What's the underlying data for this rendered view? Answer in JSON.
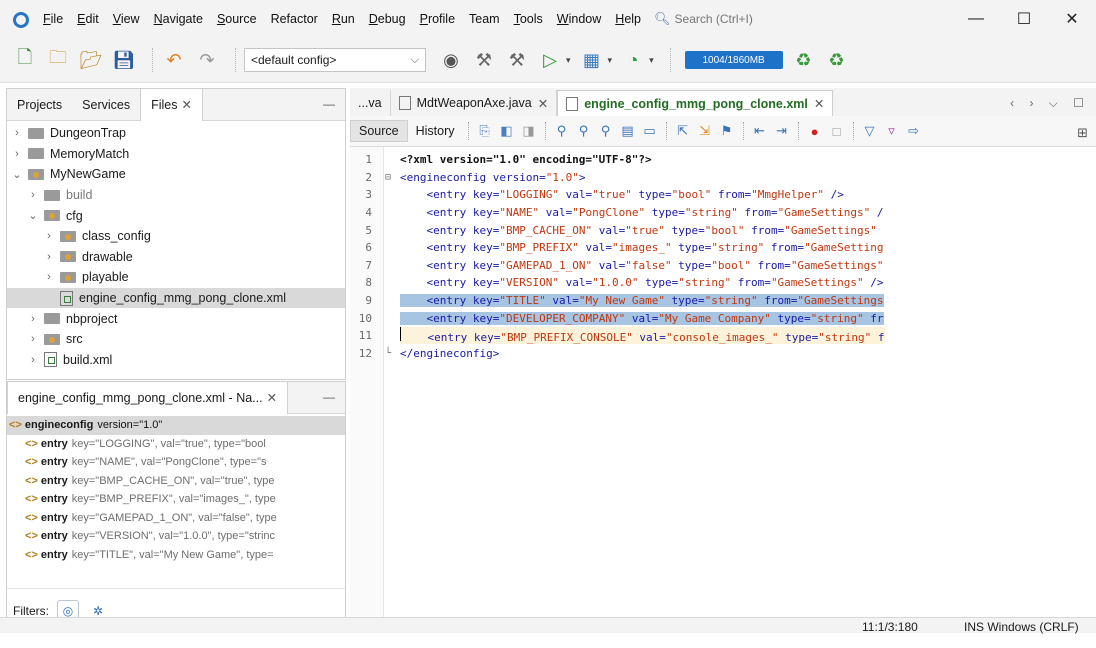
{
  "menu": {
    "items": [
      {
        "label": "File",
        "u": "F",
        "rest": "ile"
      },
      {
        "label": "Edit",
        "u": "E",
        "rest": "dit"
      },
      {
        "label": "View",
        "u": "V",
        "rest": "iew"
      },
      {
        "label": "Navigate",
        "u": "N",
        "rest": "avigate"
      },
      {
        "label": "Source",
        "u": "S",
        "rest": "ource"
      },
      {
        "label": "Refactor",
        "u": "",
        "rest": "Refactor"
      },
      {
        "label": "Run",
        "u": "R",
        "rest": "un"
      },
      {
        "label": "Debug",
        "u": "D",
        "rest": "ebug"
      },
      {
        "label": "Profile",
        "u": "P",
        "rest": "rofile"
      },
      {
        "label": "Team",
        "u": "",
        "rest": "Team"
      },
      {
        "label": "Tools",
        "u": "T",
        "rest": "ools"
      },
      {
        "label": "Window",
        "u": "W",
        "rest": "indow"
      },
      {
        "label": "Help",
        "u": "H",
        "rest": "elp"
      }
    ],
    "search_placeholder": "Search (Ctrl+I)"
  },
  "toolbar": {
    "config": "<default config>",
    "memory": "1004/1860MB"
  },
  "projects_panel": {
    "tabs": [
      "Projects",
      "Services",
      "Files"
    ],
    "tree": [
      {
        "label": "DungeonTrap",
        "indent": 0,
        "arrow": ">",
        "icon": "folder",
        "dim": false,
        "selected": false
      },
      {
        "label": "MemoryMatch",
        "indent": 0,
        "arrow": ">",
        "icon": "folder",
        "dim": false,
        "selected": false
      },
      {
        "label": "MyNewGame",
        "indent": 0,
        "arrow": "v",
        "icon": "pkg",
        "dim": false,
        "selected": false
      },
      {
        "label": "build",
        "indent": 1,
        "arrow": ">",
        "icon": "folder",
        "dim": true,
        "selected": false
      },
      {
        "label": "cfg",
        "indent": 1,
        "arrow": "v",
        "icon": "pkg",
        "dim": false,
        "selected": false
      },
      {
        "label": "class_config",
        "indent": 2,
        "arrow": ">",
        "icon": "pkg",
        "dim": false,
        "selected": false
      },
      {
        "label": "drawable",
        "indent": 2,
        "arrow": ">",
        "icon": "pkg",
        "dim": false,
        "selected": false
      },
      {
        "label": "playable",
        "indent": 2,
        "arrow": ">",
        "icon": "pkg",
        "dim": false,
        "selected": false
      },
      {
        "label": "engine_config_mmg_pong_clone.xml",
        "indent": 2,
        "arrow": "",
        "icon": "xml",
        "dim": false,
        "selected": true
      },
      {
        "label": "nbproject",
        "indent": 1,
        "arrow": ">",
        "icon": "folder",
        "dim": false,
        "selected": false
      },
      {
        "label": "src",
        "indent": 1,
        "arrow": ">",
        "icon": "pkg",
        "dim": false,
        "selected": false
      },
      {
        "label": "build.xml",
        "indent": 1,
        "arrow": ">",
        "icon": "xml",
        "dim": false,
        "selected": false
      }
    ]
  },
  "navigator": {
    "title": "engine_config_mmg_pong_clone.xml - Na...",
    "root": {
      "element": "engineconfig",
      "attrs": "version=\"1.0\""
    },
    "entries": [
      "key=\"LOGGING\", val=\"true\", type=\"bool",
      "key=\"NAME\", val=\"PongClone\", type=\"s",
      "key=\"BMP_CACHE_ON\", val=\"true\", type",
      "key=\"BMP_PREFIX\", val=\"images_\", type",
      "key=\"GAMEPAD_1_ON\", val=\"false\", type",
      "key=\"VERSION\", val=\"1.0.0\", type=\"strinc",
      "key=\"TITLE\", val=\"My New Game\", type="
    ],
    "entry_element": "entry",
    "filters_label": "Filters:"
  },
  "editor": {
    "tabs": [
      {
        "label": "...va",
        "active": false,
        "icon": false
      },
      {
        "label": "MdtWeaponAxe.java",
        "active": false,
        "icon": true
      },
      {
        "label": "engine_config_mmg_pong_clone.xml",
        "active": true,
        "icon": true
      }
    ],
    "modes": [
      "Source",
      "History"
    ],
    "lines": [
      {
        "n": "1",
        "fold": "",
        "state": "",
        "parts": [
          [
            "pi",
            "<?xml version=\"1.0\" encoding=\"UTF-8\"?>"
          ]
        ]
      },
      {
        "n": "2",
        "fold": "⊟",
        "state": "",
        "parts": [
          [
            "tag",
            "<engineconfig "
          ],
          [
            "attr",
            "version="
          ],
          [
            "str",
            "\"1.0\""
          ],
          [
            "tag",
            ">"
          ]
        ]
      },
      {
        "n": "3",
        "fold": "",
        "state": "",
        "parts": [
          [
            "plain",
            "    "
          ],
          [
            "tag",
            "<entry "
          ],
          [
            "attr",
            "key="
          ],
          [
            "str",
            "\"LOGGING\""
          ],
          [
            "attr",
            " val="
          ],
          [
            "str",
            "\"true\""
          ],
          [
            "attr",
            " type="
          ],
          [
            "str",
            "\"bool\""
          ],
          [
            "attr",
            " from="
          ],
          [
            "str",
            "\"MmgHelper\""
          ],
          [
            "tag",
            " />"
          ]
        ]
      },
      {
        "n": "4",
        "fold": "",
        "state": "",
        "parts": [
          [
            "plain",
            "    "
          ],
          [
            "tag",
            "<entry "
          ],
          [
            "attr",
            "key="
          ],
          [
            "str",
            "\"NAME\""
          ],
          [
            "attr",
            " val="
          ],
          [
            "str",
            "\"PongClone\""
          ],
          [
            "attr",
            " type="
          ],
          [
            "str",
            "\"string\""
          ],
          [
            "attr",
            " from="
          ],
          [
            "str",
            "\"GameSettings\""
          ],
          [
            "tag",
            " /"
          ]
        ]
      },
      {
        "n": "5",
        "fold": "",
        "state": "",
        "parts": [
          [
            "plain",
            "    "
          ],
          [
            "tag",
            "<entry "
          ],
          [
            "attr",
            "key="
          ],
          [
            "str",
            "\"BMP_CACHE_ON\""
          ],
          [
            "attr",
            " val="
          ],
          [
            "str",
            "\"true\""
          ],
          [
            "attr",
            " type="
          ],
          [
            "str",
            "\"bool\""
          ],
          [
            "attr",
            " from="
          ],
          [
            "str",
            "\"GameSettings\""
          ]
        ]
      },
      {
        "n": "6",
        "fold": "",
        "state": "",
        "parts": [
          [
            "plain",
            "    "
          ],
          [
            "tag",
            "<entry "
          ],
          [
            "attr",
            "key="
          ],
          [
            "str",
            "\"BMP_PREFIX\""
          ],
          [
            "attr",
            " val="
          ],
          [
            "str",
            "\"images_\""
          ],
          [
            "attr",
            " type="
          ],
          [
            "str",
            "\"string\""
          ],
          [
            "attr",
            " from="
          ],
          [
            "str",
            "\"GameSetting"
          ]
        ]
      },
      {
        "n": "7",
        "fold": "",
        "state": "",
        "parts": [
          [
            "plain",
            "    "
          ],
          [
            "tag",
            "<entry "
          ],
          [
            "attr",
            "key="
          ],
          [
            "str",
            "\"GAMEPAD_1_ON\""
          ],
          [
            "attr",
            " val="
          ],
          [
            "str",
            "\"false\""
          ],
          [
            "attr",
            " type="
          ],
          [
            "str",
            "\"bool\""
          ],
          [
            "attr",
            " from="
          ],
          [
            "str",
            "\"GameSettings\""
          ]
        ]
      },
      {
        "n": "8",
        "fold": "",
        "state": "",
        "parts": [
          [
            "plain",
            "    "
          ],
          [
            "tag",
            "<entry "
          ],
          [
            "attr",
            "key="
          ],
          [
            "str",
            "\"VERSION\""
          ],
          [
            "attr",
            " val="
          ],
          [
            "str",
            "\"1.0.0\""
          ],
          [
            "attr",
            " type="
          ],
          [
            "str",
            "\"string\""
          ],
          [
            "attr",
            " from="
          ],
          [
            "str",
            "\"GameSettings\""
          ],
          [
            "tag",
            " />"
          ]
        ]
      },
      {
        "n": "9",
        "fold": "",
        "state": "sel",
        "parts": [
          [
            "plain",
            "    "
          ],
          [
            "tag",
            "<entry "
          ],
          [
            "attr",
            "key="
          ],
          [
            "str",
            "\"TITLE\""
          ],
          [
            "attr",
            " val="
          ],
          [
            "str",
            "\"My New Game\""
          ],
          [
            "attr",
            " type="
          ],
          [
            "str",
            "\"string\""
          ],
          [
            "attr",
            " from="
          ],
          [
            "str",
            "\"GameSettings"
          ]
        ]
      },
      {
        "n": "10",
        "fold": "",
        "state": "sel",
        "parts": [
          [
            "plain",
            "    "
          ],
          [
            "tag",
            "<entry "
          ],
          [
            "attr",
            "key="
          ],
          [
            "str",
            "\"DEVELOPER_COMPANY\""
          ],
          [
            "attr",
            " val="
          ],
          [
            "str",
            "\"My Game Company\""
          ],
          [
            "attr",
            " type="
          ],
          [
            "str",
            "\"string\""
          ],
          [
            "attr",
            " fr"
          ]
        ]
      },
      {
        "n": "11",
        "fold": "",
        "state": "cur",
        "parts": [
          [
            "plain",
            "    "
          ],
          [
            "tag",
            "<entry "
          ],
          [
            "attr",
            "key="
          ],
          [
            "str",
            "\"BMP_PREFIX_CONSOLE\""
          ],
          [
            "attr",
            " val="
          ],
          [
            "str",
            "\"console_images_\""
          ],
          [
            "attr",
            " type="
          ],
          [
            "str",
            "\"string\""
          ],
          [
            "attr",
            " f"
          ]
        ]
      },
      {
        "n": "12",
        "fold": "└",
        "state": "",
        "parts": [
          [
            "tag",
            "</engineconfig>"
          ]
        ]
      }
    ]
  },
  "status": {
    "position": "11:1/3:180",
    "mode": "INS Windows (CRLF)"
  }
}
